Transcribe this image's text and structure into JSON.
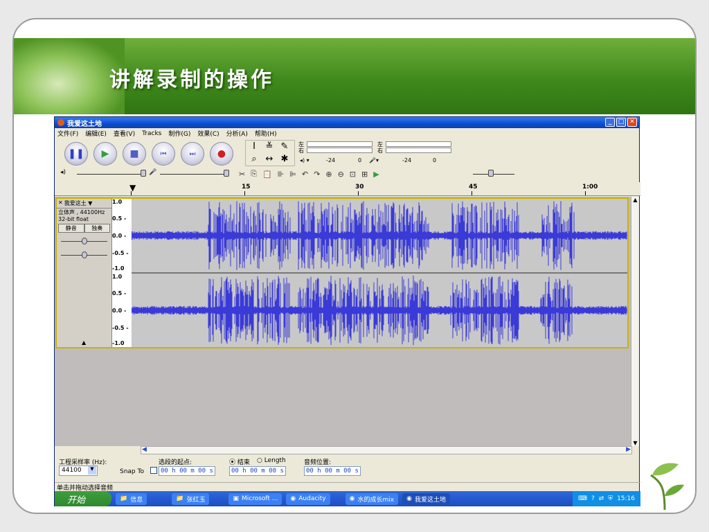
{
  "slide": {
    "title": "讲解录制的操作"
  },
  "window": {
    "title": "我爱这土地",
    "buttons": {
      "minimize": "_",
      "maximize": "□",
      "close": "✕"
    }
  },
  "menu": [
    "文件(F)",
    "编辑(E)",
    "查看(V)",
    "Tracks",
    "制作(G)",
    "效果(C)",
    "分析(A)",
    "帮助(H)"
  ],
  "meters": {
    "left": "左",
    "right": "右",
    "db1": "-24",
    "zero1": "0",
    "db2": "-24",
    "zero2": "0"
  },
  "ruler": {
    "labels": [
      "15",
      "30",
      "45",
      "1:00"
    ]
  },
  "track": {
    "name": "我爱这土 ▼",
    "format": "立体声 , 44100Hz",
    "bits": "32-bit float",
    "mute": "静音",
    "solo": "独奏",
    "scale": [
      "1.0",
      "0.5 -",
      "0.0 -",
      "-0.5 -",
      "-1.0"
    ]
  },
  "selection": {
    "rate_label": "工程采样率 (Hz):",
    "rate_value": "44100",
    "snap_label": "Snap To",
    "start_label": "选段的起点:",
    "end_label": "结束",
    "length_label": "Length",
    "pos_label": "音频位置:",
    "time1": "00 h 00 m 00 s",
    "time2": "00 h 00 m 00 s",
    "time3": "00 h 00 m 00 s"
  },
  "status": "单击并拖动选择音频",
  "taskbar": {
    "start": "开始",
    "tasks": [
      "信息",
      "张红玉",
      "Microsoft ...",
      "Audacity",
      "水的成长mix",
      "我爱这土地"
    ],
    "clock": "15:16"
  },
  "colors": {
    "wave": "#3a3ad8",
    "banner": "#3f8a1c"
  }
}
